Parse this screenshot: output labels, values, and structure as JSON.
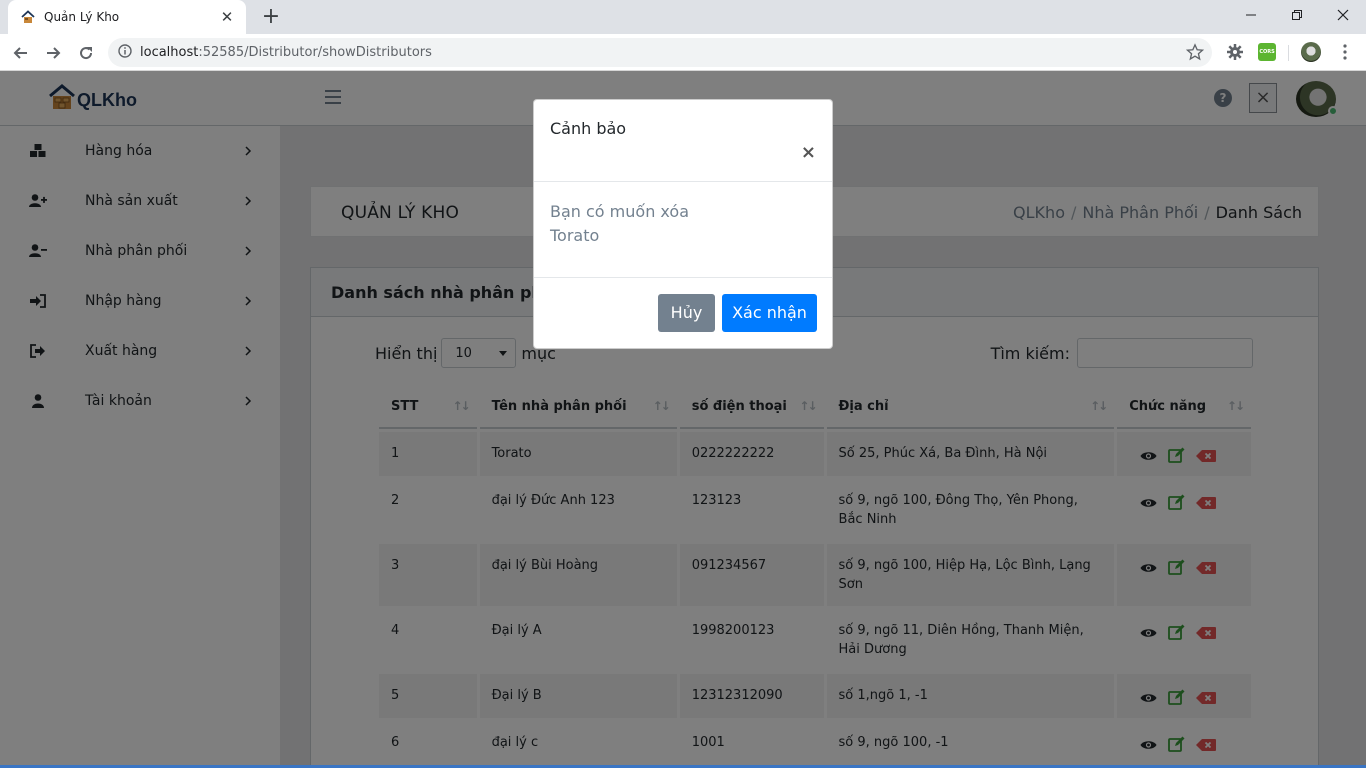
{
  "browser": {
    "tab_title": "Quản Lý Kho",
    "url_host": "localhost",
    "url_path": ":52585/Distributor/showDistributors",
    "icons": [
      "home-icon",
      "close-icon",
      "plus-icon",
      "minimize-icon",
      "restore-icon",
      "back-icon",
      "forward-icon",
      "reload-icon",
      "info-icon",
      "star-icon",
      "extension-gear-icon",
      "cors-extension-icon",
      "profile-icon",
      "menu-dots-icon"
    ],
    "cors_label": "CORS"
  },
  "header": {
    "brand": "QLKho",
    "help_icon": "?",
    "close_icon": "×"
  },
  "sidebar": {
    "items": [
      {
        "label": "Hàng hóa",
        "icon": "boxes-icon"
      },
      {
        "label": "Nhà sản xuất",
        "icon": "user-plus-icon"
      },
      {
        "label": "Nhà phân phối",
        "icon": "user-minus-icon"
      },
      {
        "label": "Nhập hàng",
        "icon": "sign-in-icon"
      },
      {
        "label": "Xuất hàng",
        "icon": "sign-out-icon"
      },
      {
        "label": "Tài khoản",
        "icon": "user-icon"
      }
    ]
  },
  "page": {
    "title": "QUẢN LÝ KHO",
    "breadcrumb": [
      "QLKho",
      "Nhà Phân Phối",
      "Danh Sách"
    ],
    "breadcrumb_sep": "/"
  },
  "card": {
    "title": "Danh sách nhà phân phối",
    "show_label": "Hiển thị",
    "page_length": "10",
    "entries_label": "mục",
    "search_label": "Tìm kiếm:",
    "search_value": ""
  },
  "table": {
    "columns": [
      "STT",
      "Tên nhà phân phối",
      "số điện thoại",
      "Địa chỉ",
      "Chức năng"
    ],
    "sort_glyph": "↑↓",
    "rows": [
      {
        "stt": "1",
        "name": "Torato",
        "phone": "0222222222",
        "address": "Số 25, Phúc Xá, Ba Đình, Hà Nội"
      },
      {
        "stt": "2",
        "name": "đại lý Đức Anh 123",
        "phone": "123123",
        "address": "số 9, ngõ 100, Đông Thọ, Yên Phong, Bắc Ninh"
      },
      {
        "stt": "3",
        "name": "đại lý Bùi Hoàng",
        "phone": "091234567",
        "address": "số 9, ngõ 100, Hiệp Hạ, Lộc Bình, Lạng Sơn"
      },
      {
        "stt": "4",
        "name": "Đại lý A",
        "phone": "1998200123",
        "address": "số 9, ngõ 11, Diên Hồng, Thanh Miện, Hải Dương"
      },
      {
        "stt": "5",
        "name": "Đại lý B",
        "phone": "12312312090",
        "address": "số 1,ngõ 1, -1"
      },
      {
        "stt": "6",
        "name": "đại lý c",
        "phone": "1001",
        "address": "số 9, ngõ 100, -1"
      }
    ]
  },
  "modal": {
    "title": "Cảnh bảo",
    "close": "×",
    "message": "Bạn có muốn xóa",
    "target": "Torato",
    "cancel_label": "Hủy",
    "confirm_label": "Xác nhận"
  },
  "colors": {
    "primary": "#007bff",
    "secondary": "#73818f",
    "success": "#4dbd74",
    "danger": "#e55353"
  }
}
